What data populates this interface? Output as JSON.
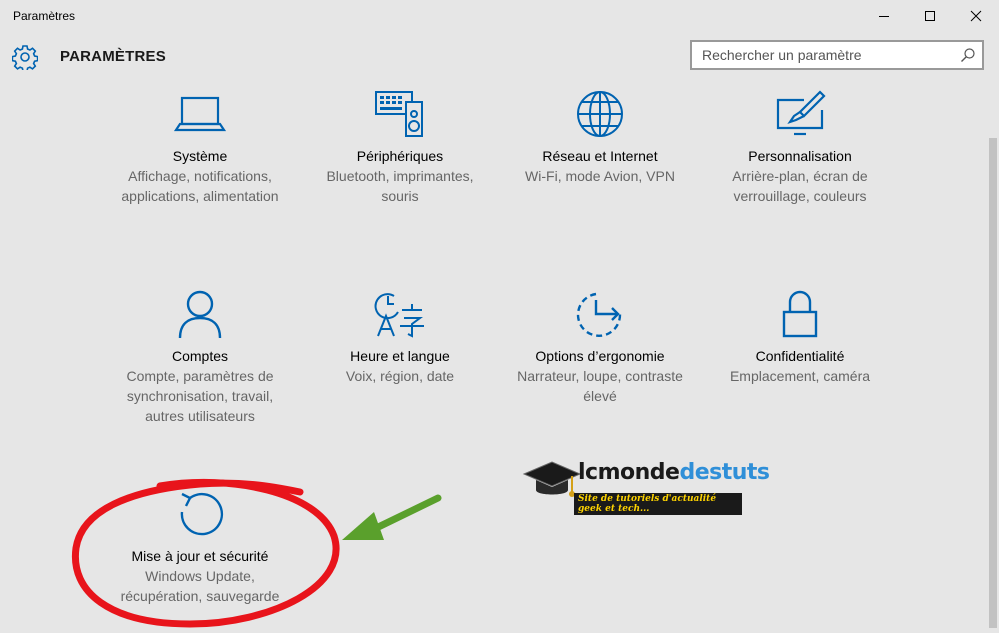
{
  "window": {
    "title": "Paramètres"
  },
  "header": {
    "title": "PARAMÈTRES",
    "icon": "gear-icon"
  },
  "search": {
    "placeholder": "Rechercher un paramètre",
    "icon": "search-icon"
  },
  "colors": {
    "accent": "#0063b1",
    "background": "#e6e6e6",
    "annotation_circle": "#e8141b",
    "annotation_arrow": "#5aa02c"
  },
  "tiles": [
    {
      "id": "systeme",
      "icon": "laptop-icon",
      "title": "Système",
      "description": "Affichage, notifications, applications, alimentation"
    },
    {
      "id": "peripheriques",
      "icon": "keyboard-speaker-icon",
      "title": "Périphériques",
      "description": "Bluetooth, imprimantes, souris"
    },
    {
      "id": "reseau",
      "icon": "globe-icon",
      "title": "Réseau et Internet",
      "description": "Wi-Fi, mode Avion, VPN"
    },
    {
      "id": "personnalisation",
      "icon": "paint-monitor-icon",
      "title": "Personnalisation",
      "description": "Arrière-plan, écran de verrouillage, couleurs"
    },
    {
      "id": "comptes",
      "icon": "person-icon",
      "title": "Comptes",
      "description": "Compte, paramètres de synchronisation, travail, autres utilisateurs"
    },
    {
      "id": "heure",
      "icon": "time-language-icon",
      "title": "Heure et langue",
      "description": "Voix, région, date"
    },
    {
      "id": "ergonomie",
      "icon": "ease-of-access-icon",
      "title": "Options d’ergonomie",
      "description": "Narrateur, loupe, contraste élevé"
    },
    {
      "id": "confidentialite",
      "icon": "lock-icon",
      "title": "Confidentialité",
      "description": "Emplacement, caméra"
    },
    {
      "id": "maj",
      "icon": "refresh-icon",
      "title": "Mise à jour et sécurité",
      "description": "Windows Update, récupération, sauvegarde"
    }
  ],
  "watermark": {
    "part1": "lcmonde",
    "part2": "destuts",
    "subtitle": "Site de tutoriels d'actualité geek et tech..."
  }
}
